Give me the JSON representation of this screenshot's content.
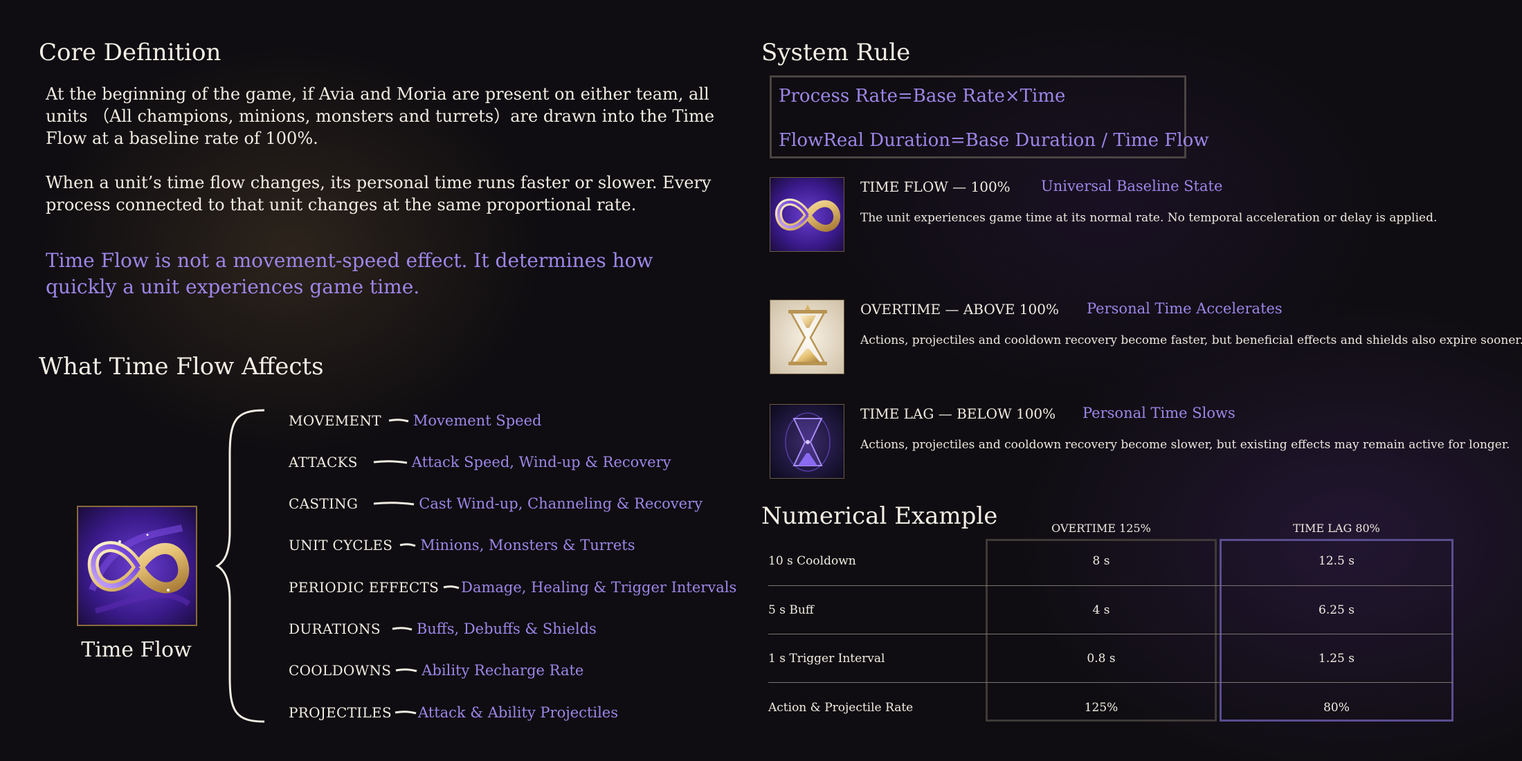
{
  "core": {
    "title": "Core Definition",
    "para1": "At the beginning of the game, if Avia and Moria are present on either team, all units （All champions, minions, monsters and turrets）are drawn into the Time Flow at a baseline rate of 100%.",
    "para2": "When a unit’s time flow changes, its personal time runs faster or slower. Every process connected to that unit changes at the same proportional rate.",
    "highlight": "Time Flow is not a movement-speed effect. It determines how quickly a unit experiences game time."
  },
  "affects": {
    "title": "What Time Flow Affects",
    "icon_name": "time-flow-infinity-icon",
    "icon_label": "Time Flow",
    "items": [
      {
        "key": "MOVEMENT",
        "value": "Movement Speed"
      },
      {
        "key": "ATTACKS",
        "value": "Attack Speed, Wind-up & Recovery"
      },
      {
        "key": "CASTING",
        "value": "Cast Wind-up, Channeling & Recovery"
      },
      {
        "key": "UNIT CYCLES",
        "value": "Minions, Monsters & Turrets"
      },
      {
        "key": "PERIODIC EFFECTS",
        "value": "Damage, Healing & Trigger Intervals"
      },
      {
        "key": "DURATIONS",
        "value": "Buffs, Debuffs & Shields"
      },
      {
        "key": "COOLDOWNS",
        "value": "Ability Recharge Rate"
      },
      {
        "key": "PROJECTILES",
        "value": "Attack & Ability Projectiles"
      }
    ]
  },
  "rule": {
    "title": "System Rule",
    "line1": "Process Rate=Base Rate×Time",
    "line2": "FlowReal Duration=Base Duration / Time Flow"
  },
  "states": [
    {
      "icon": "infinity-icon",
      "heading": "TIME FLOW — 100%",
      "tag": "Universal Baseline State",
      "desc": "The unit experiences game time at its normal rate. No temporal acceleration or delay is applied."
    },
    {
      "icon": "golden-hourglass-icon",
      "heading": "OVERTIME — ABOVE 100%",
      "tag": "Personal Time Accelerates",
      "desc": "Actions, projectiles and cooldown recovery become faster, but beneficial effects and shields also expire sooner."
    },
    {
      "icon": "violet-hourglass-icon",
      "heading": "TIME LAG — BELOW 100%",
      "tag": "Personal Time Slows",
      "desc": "Actions, projectiles and cooldown recovery become slower, but existing effects may remain active for longer."
    }
  ],
  "numerical": {
    "title": "Numerical Example",
    "columns": [
      "OVERTIME 125%",
      "TIME LAG 80%"
    ],
    "rows": [
      {
        "label": "10 s Cooldown",
        "overtime": "8 s",
        "lag": "12.5 s"
      },
      {
        "label": "5 s Buff",
        "overtime": "4 s",
        "lag": "6.25 s"
      },
      {
        "label": "1 s Trigger Interval",
        "overtime": "0.8 s",
        "lag": "1.25 s"
      },
      {
        "label": "Action & Projectile Rate",
        "overtime": "125%",
        "lag": "80%"
      }
    ]
  },
  "colors": {
    "accent": "#9d86e8",
    "text": "#f1ece2",
    "gold": "#d8b56a",
    "background": "#0f0d11"
  }
}
